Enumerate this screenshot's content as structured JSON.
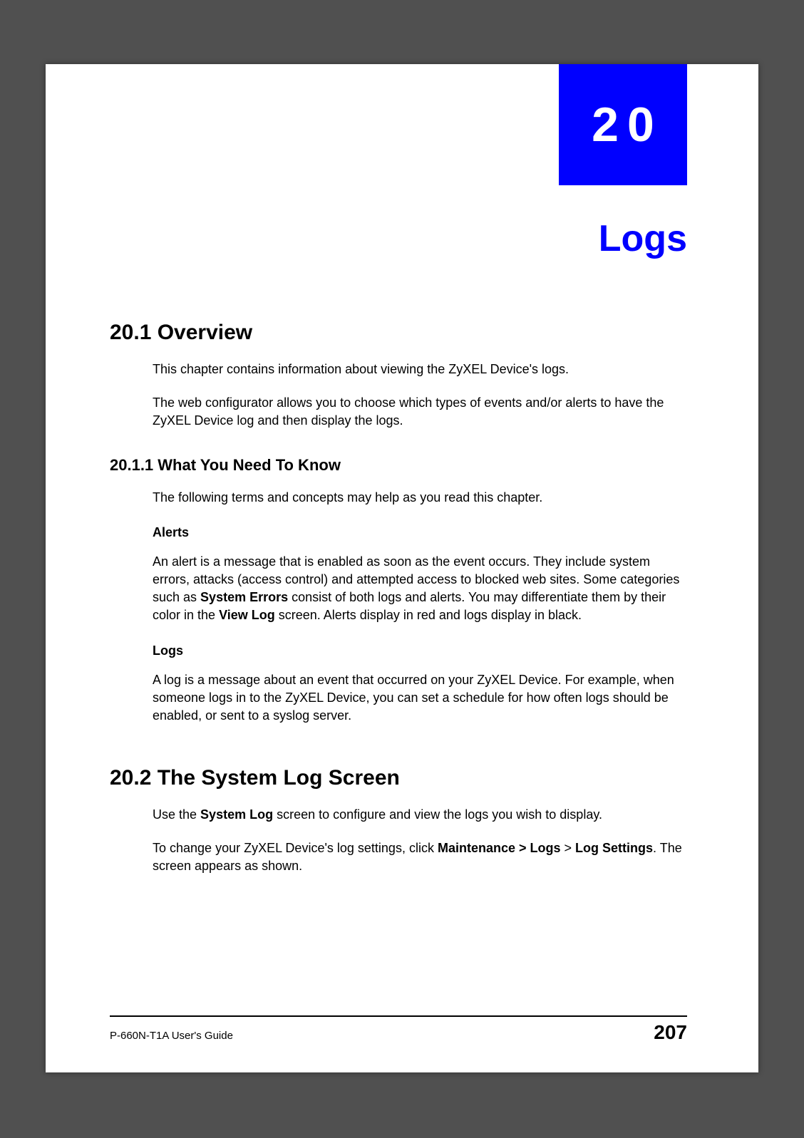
{
  "chapter": {
    "number": "20",
    "title": "Logs"
  },
  "sections": {
    "s1": {
      "heading": "20.1  Overview",
      "p1": "This chapter contains information about viewing the ZyXEL Device's logs.",
      "p2": "The web configurator allows you to choose which types of events and/or alerts to have the ZyXEL Device log and then display the logs."
    },
    "s1_1": {
      "heading": "20.1.1  What You Need To Know",
      "p1": "The following terms and concepts may help as you read this chapter.",
      "alerts_heading": "Alerts",
      "alerts_p_a": "An alert is a message that is enabled as soon as the event occurs. They include system errors, attacks (access control) and attempted access to blocked web sites. Some categories such as ",
      "alerts_bold1": "System Errors",
      "alerts_p_b": " consist of both logs and alerts. You may differentiate them by their color in the ",
      "alerts_bold2": "View Log",
      "alerts_p_c": " screen. Alerts display in red and logs display in black.",
      "logs_heading": "Logs",
      "logs_p": "A log is a message about an event that occurred on your ZyXEL Device. For example, when someone logs in to the ZyXEL Device, you can set a schedule for how often logs should be enabled, or sent to a syslog server."
    },
    "s2": {
      "heading": "20.2  The System Log Screen",
      "p1_a": "Use the ",
      "p1_bold1": "System Log",
      "p1_b": " screen to configure and view the logs you wish to display.",
      "p2_a": "To change your ZyXEL Device's log settings, click ",
      "p2_bold1": "Maintenance > Logs",
      "p2_b": " > ",
      "p2_bold2": "Log Settings",
      "p2_c": ". The screen appears as shown."
    }
  },
  "footer": {
    "guide": "P-660N-T1A User's Guide",
    "page": "207"
  }
}
